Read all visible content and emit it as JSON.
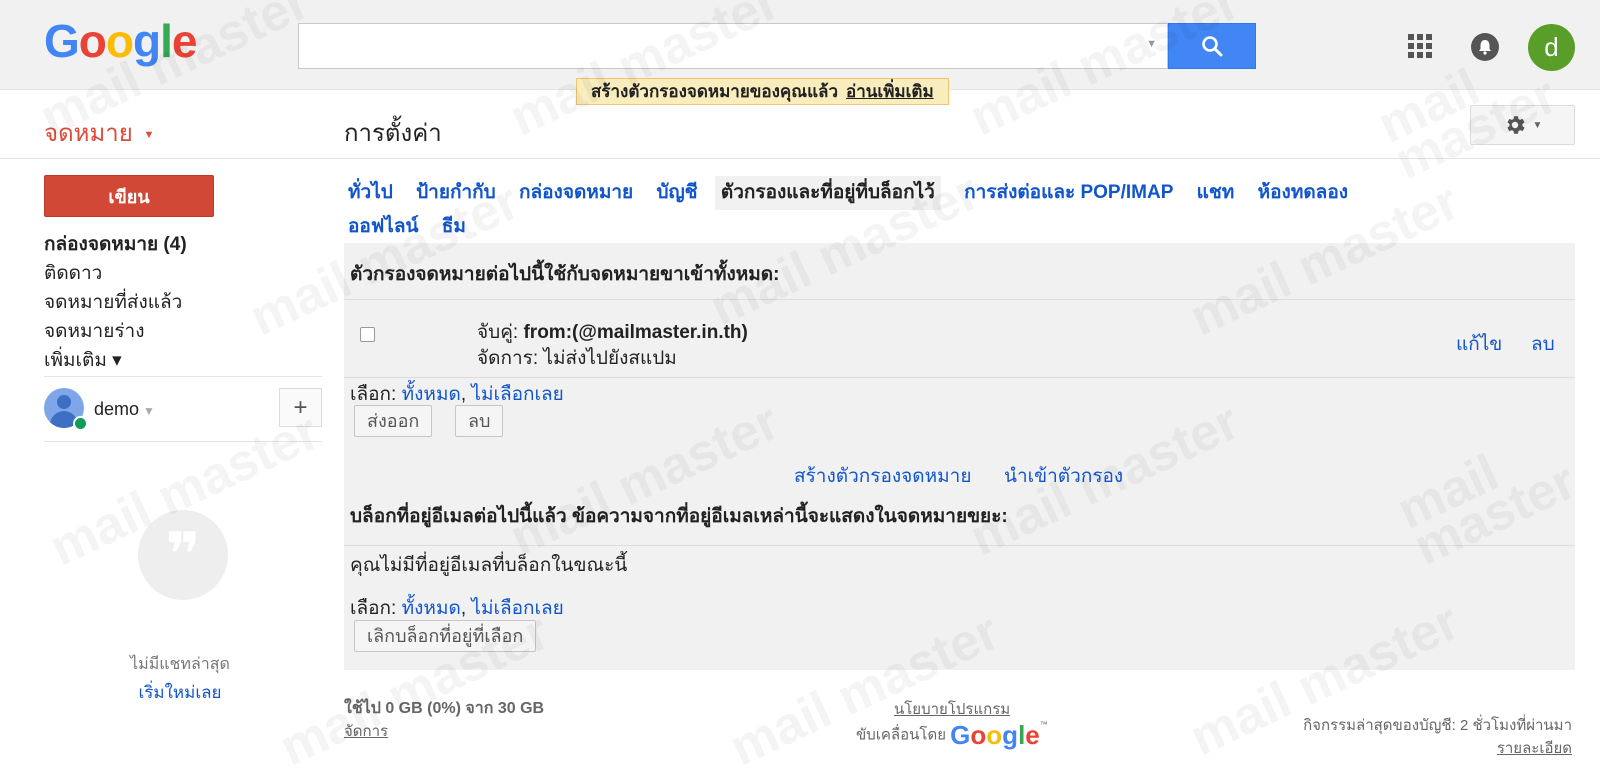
{
  "header": {
    "logo": [
      "G",
      "o",
      "o",
      "g",
      "l",
      "e"
    ],
    "logo_colors": [
      "#4285f4",
      "#ea4335",
      "#fbbc05",
      "#4285f4",
      "#34a853",
      "#ea4335"
    ],
    "search_placeholder": "",
    "search_dropdown": "▼",
    "avatar_letter": "d",
    "accent_color": "#4285f4"
  },
  "notice": {
    "text": "สร้างตัวกรองจดหมายของคุณแล้ว",
    "link": "อ่านเพิ่มเติม"
  },
  "toolbar": {
    "mail_label": "จดหมาย",
    "mail_caret": "▼",
    "page_title": "การตั้งค่า",
    "gear_caret": "▼"
  },
  "sidebar": {
    "compose": "เขียน",
    "items": [
      {
        "label": "กล่องจดหมาย (4)",
        "bold": true
      },
      {
        "label": "ติดดาว",
        "bold": false
      },
      {
        "label": "จดหมายที่ส่งแล้ว",
        "bold": false
      },
      {
        "label": "จดหมายร่าง",
        "bold": false
      },
      {
        "label": "เพิ่มเติม ▾",
        "bold": false
      }
    ],
    "user_name": "demo",
    "user_caret": "▼",
    "add_label": "+",
    "no_chat": "ไม่มีแชทล่าสุด",
    "start_new": "เริ่มใหม่เลย"
  },
  "tabs": [
    {
      "label": "ทั่วไป",
      "active": false
    },
    {
      "label": "ป้ายกำกับ",
      "active": false
    },
    {
      "label": "กล่องจดหมาย",
      "active": false
    },
    {
      "label": "บัญชี",
      "active": false
    },
    {
      "label": "ตัวกรองและที่อยู่ที่บล็อกไว้",
      "active": true
    },
    {
      "label": "การส่งต่อและ POP/IMAP",
      "active": false
    },
    {
      "label": "แชท",
      "active": false
    },
    {
      "label": "ห้องทดลอง",
      "active": false
    },
    {
      "label": "ออฟไลน์",
      "active": false
    },
    {
      "label": "ธีม",
      "active": false
    }
  ],
  "filters": {
    "heading": "ตัวกรองจดหมายต่อไปนี้ใช้กับจดหมายขาเข้าทั้งหมด:",
    "match_label": "จับคู่:",
    "match_value": "from:(@mailmaster.in.th)",
    "action_label": "จัดการ:",
    "action_value": "ไม่ส่งไปยังสแปม",
    "edit": "แก้ไข",
    "delete": "ลบ",
    "select_label": "เลือก:",
    "select_all": "ทั้งหมด",
    "select_none": "ไม่เลือกเลย",
    "export_btn": "ส่งออก",
    "delete_btn": "ลบ",
    "create_filter": "สร้างตัวกรองจดหมาย",
    "import_filter": "นำเข้าตัวกรอง"
  },
  "blocked": {
    "heading": "บล็อกที่อยู่อีเมลต่อไปนี้แล้ว ข้อความจากที่อยู่อีเมลเหล่านี้จะแสดงในจดหมายขยะ:",
    "empty": "คุณไม่มีที่อยู่อีเมลที่บล็อกในขณะนี้",
    "select_label": "เลือก:",
    "select_all": "ทั้งหมด",
    "select_none": "ไม่เลือกเลย",
    "unblock_btn": "เลิกบล็อกที่อยู่ที่เลือก"
  },
  "footer": {
    "storage": "ใช้ไป 0 GB (0%) จาก 30 GB",
    "manage": "จัดการ",
    "policy": "นโยบายโปรแกรม",
    "powered_by": "ขับเคลื่อนโดย",
    "google_letters": [
      "G",
      "o",
      "o",
      "g",
      "l",
      "e"
    ],
    "tm": "™",
    "activity": "กิจกรรมล่าสุดของบัญชี: 2 ชั่วโมงที่ผ่านมา",
    "details": "รายละเอียด"
  },
  "watermark": "mail master"
}
